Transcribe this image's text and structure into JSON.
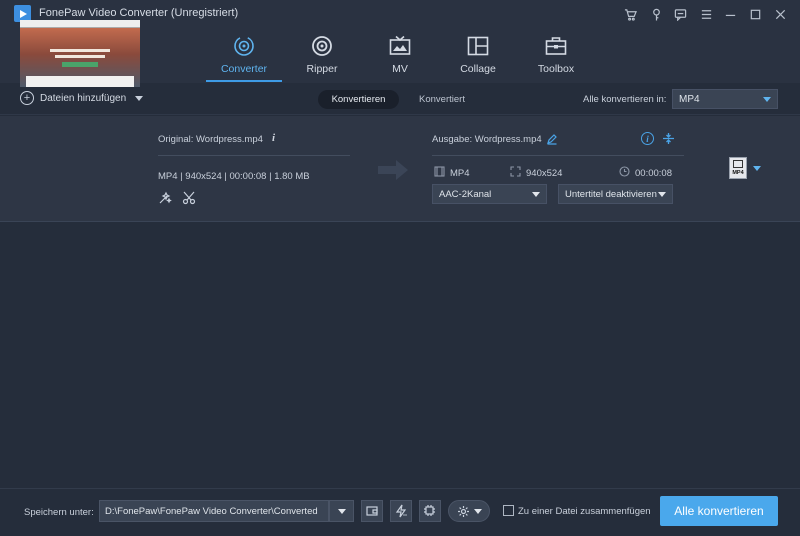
{
  "window": {
    "title": "FonePaw Video Converter (Unregistriert)"
  },
  "nav": {
    "tabs": [
      {
        "label": "Converter",
        "icon": "converter-icon"
      },
      {
        "label": "Ripper",
        "icon": "disc-icon"
      },
      {
        "label": "MV",
        "icon": "tv-icon"
      },
      {
        "label": "Collage",
        "icon": "collage-icon"
      },
      {
        "label": "Toolbox",
        "icon": "toolbox-icon"
      }
    ],
    "active": "Converter",
    "accent_color": "#3e9be6"
  },
  "toolbar": {
    "add_files_label": "Dateien hinzufügen",
    "tab_converting": "Konvertieren",
    "tab_converted": "Konvertiert",
    "convert_all_to_label": "Alle konvertieren in:",
    "convert_all_to_value": "MP4"
  },
  "file": {
    "original_label": "Original: Wordpress.mp4",
    "source_meta": "MP4 | 940x524 | 00:00:08 | 1.80 MB",
    "output_label": "Ausgabe: Wordpress.mp4",
    "output_format": "MP4",
    "output_resolution": "940x524",
    "output_duration": "00:00:08",
    "audio_track": "AAC-2Kanal",
    "subtitle": "Untertitel deaktivieren",
    "format_badge": "MP4"
  },
  "footer": {
    "save_label": "Speichern unter:",
    "save_path": "D:\\FonePaw\\FonePaw Video Converter\\Converted",
    "merge_label": "Zu einer Datei zusammenfügen",
    "merge_checked": false,
    "convert_all_button": "Alle konvertieren",
    "button_color": "#4aa8ec"
  }
}
